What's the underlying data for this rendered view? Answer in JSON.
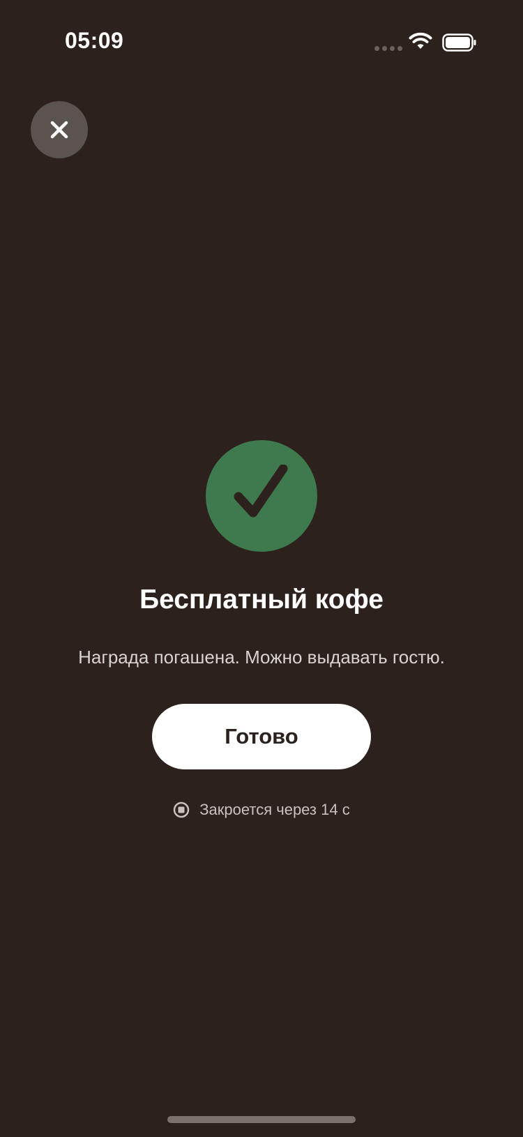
{
  "status_bar": {
    "time": "05:09"
  },
  "icons": {
    "close": "close-icon",
    "success": "checkmark-icon",
    "timer": "stop-icon",
    "wifi": "wifi-icon",
    "battery": "battery-icon"
  },
  "colors": {
    "background": "#2c211d",
    "success_green": "#3e7a4d",
    "button_bg": "#ffffff",
    "button_text": "#2c211d"
  },
  "confirmation": {
    "title": "Бесплатный кофе",
    "subtitle": "Награда погашена. Можно выдавать гостю.",
    "done_label": "Готово",
    "auto_close_text": "Закроется через 14 с"
  }
}
